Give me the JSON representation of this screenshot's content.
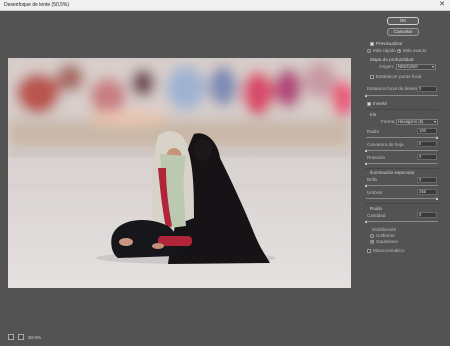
{
  "window": {
    "title": "Desenfoque de lente (50,5%)",
    "close_glyph": "✕"
  },
  "buttons": {
    "ok": "OK",
    "cancel": "Cancelar"
  },
  "options": {
    "preview": {
      "label": "Previsualizar",
      "checked": true
    },
    "mode_fast": "Más rápido",
    "mode_precise": "Más exacto",
    "mode_selected": "precise"
  },
  "depth_map": {
    "header": "Mapa de profundidad",
    "origin_label": "Origen:",
    "origin_value": "NINGUNO",
    "set_focal": "Establecer punto focal",
    "focal_distance_label": "Distancia focal de desenfoque",
    "focal_distance_value": "0",
    "invert": {
      "label": "Invertir",
      "checked": true
    }
  },
  "iris": {
    "header": "Iris",
    "shape_label": "Forma:",
    "shape_value": "Hexágono (6)",
    "radius_label": "Radio",
    "radius_value": "100",
    "radius_level": 1.0,
    "curvature_label": "Curvatura de hoja",
    "curvature_value": "0",
    "curvature_level": 0,
    "rotation_label": "Rotación",
    "rotation_value": "0",
    "rotation_level": 0
  },
  "specular": {
    "header": "Iluminación especular",
    "brightness_label": "Brillo",
    "brightness_value": "0",
    "brightness_level": 0,
    "threshold_label": "Umbral",
    "threshold_value": "255",
    "threshold_level": 1.0
  },
  "noise": {
    "header": "Ruido",
    "amount_label": "Cantidad",
    "amount_value": "0",
    "amount_level": 0,
    "distribution_label": "Distribución",
    "uniform": "Uniforme",
    "gaussian": "Gaussiano",
    "distribution_selected": "gaussian",
    "monochrome": {
      "label": "Monocromático",
      "checked": false
    }
  },
  "footer": {
    "zoom": "30,9%"
  },
  "colors": {
    "dialog_bg": "#535353",
    "panel_field": "#3b3b3b",
    "accent_scarf_red": "#b0253a"
  }
}
